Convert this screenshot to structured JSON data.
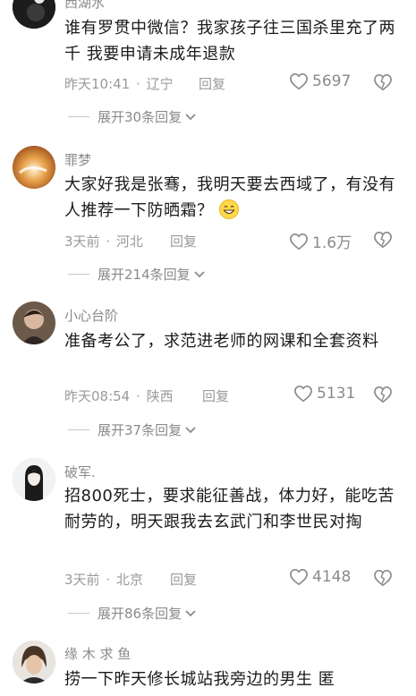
{
  "comments": [
    {
      "username": "西湖水",
      "content": "谁有罗贯中微信？我家孩子往三国杀里充了两千 我要申请未成年退款",
      "time": "昨天10:41",
      "location": "辽宁",
      "reply_label": "回复",
      "likes": "5697",
      "expand": "展开30条回复"
    },
    {
      "username": "罪梦",
      "content": "大家好我是张骞，我明天要去西域了，有没有人推荐一下防晒霜？",
      "time": "3天前",
      "location": "河北",
      "reply_label": "回复",
      "likes": "1.6万",
      "expand": "展开214条回复"
    },
    {
      "username": "小心台阶",
      "content": "准备考公了，求范进老师的网课和全套资料",
      "time": "昨天08:54",
      "location": "陕西",
      "reply_label": "回复",
      "likes": "5131",
      "expand": "展开37条回复"
    },
    {
      "username": "破军.",
      "content": "招800死士，要求能征善战，体力好，能吃苦耐劳的，明天跟我去玄武门和李世民对掏",
      "time": "3天前",
      "location": "北京",
      "reply_label": "回复",
      "likes": "4148",
      "expand": "展开86条回复"
    },
    {
      "username": "缘 木 求 鱼",
      "content": "捞一下昨天修长城站我旁边的男生 匿"
    }
  ],
  "meta_separator": "·",
  "colors": {
    "text": "#1a1a1a",
    "muted": "#9a9a9a",
    "emoji": "#ffd84a"
  },
  "icons": [
    "heart-icon",
    "broken-heart-icon",
    "chevron-down-icon",
    "grinning-emoji"
  ]
}
